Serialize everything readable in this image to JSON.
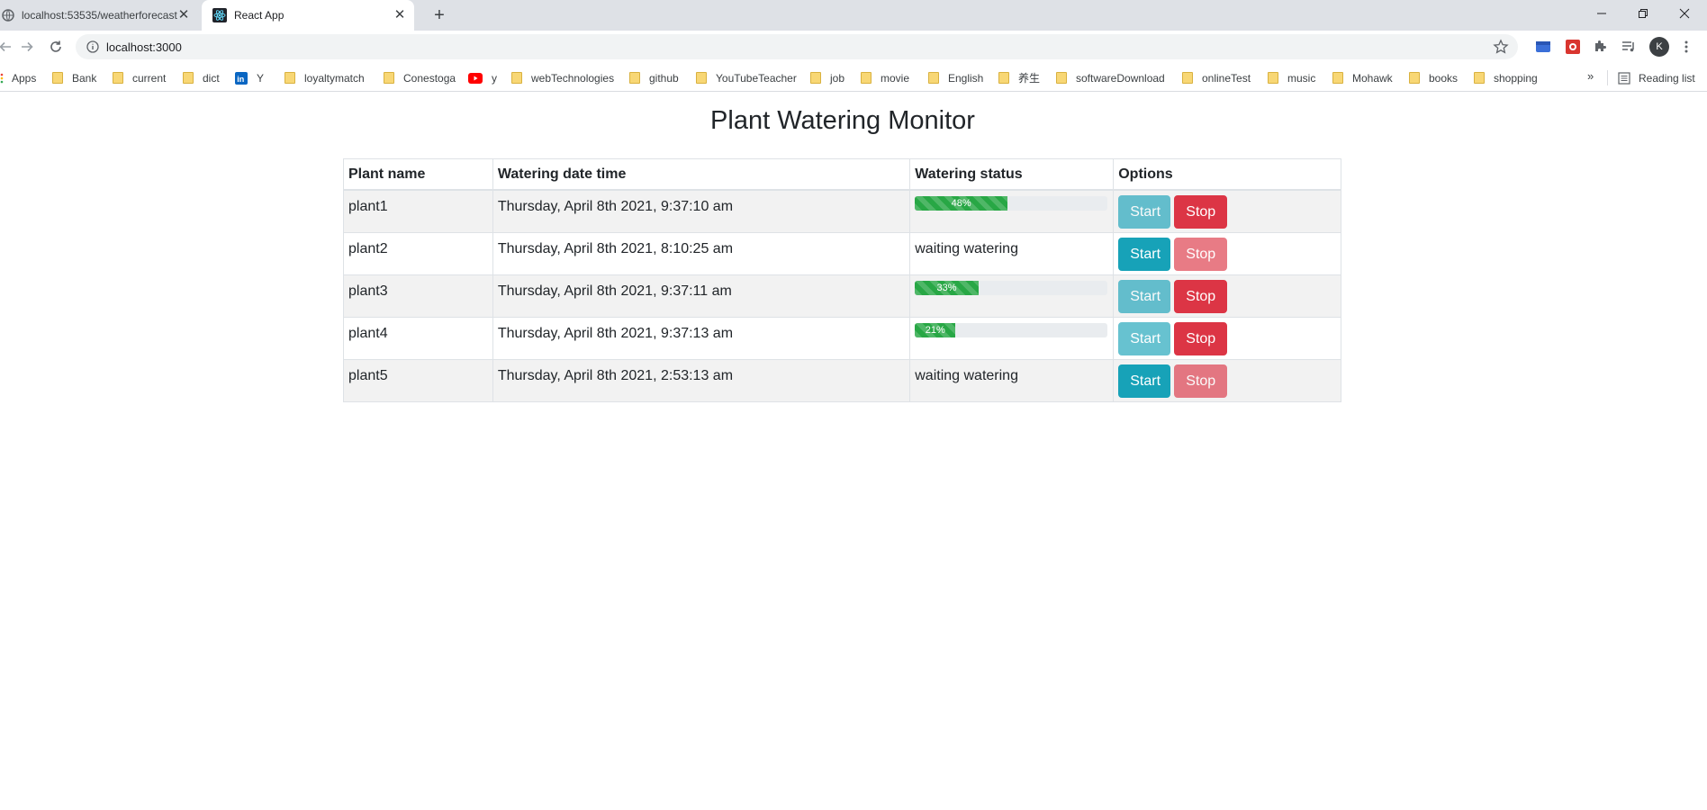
{
  "browser": {
    "tabs": [
      {
        "title": "localhost:53535/weatherforecast",
        "active": false
      },
      {
        "title": "React App",
        "active": true
      }
    ],
    "url": "localhost:3000",
    "profile_initial": "K",
    "bookmarks": [
      "Apps",
      "Bank",
      "current",
      "dict",
      "Y",
      "loyaltymatch",
      "Conestoga",
      "y",
      "webTechnologies",
      "github",
      "YouTubeTeacher",
      "job",
      "movie",
      "English",
      "养生",
      "softwareDownload",
      "onlineTest",
      "music",
      "Mohawk",
      "books",
      "shopping"
    ],
    "reading_list": "Reading list",
    "more": "»"
  },
  "page": {
    "title": "Plant Watering Monitor",
    "columns": [
      "Plant name",
      "Watering date time",
      "Watering status",
      "Options"
    ],
    "start_label": "Start",
    "stop_label": "Stop",
    "rows": [
      {
        "name": "plant1",
        "datetime": "Thursday, April 8th 2021, 9:37:10 am",
        "progress": 48,
        "progress_label": "48%",
        "status_text": "",
        "watering": true
      },
      {
        "name": "plant2",
        "datetime": "Thursday, April 8th 2021, 8:10:25 am",
        "progress": null,
        "progress_label": "",
        "status_text": "waiting watering",
        "watering": false
      },
      {
        "name": "plant3",
        "datetime": "Thursday, April 8th 2021, 9:37:11 am",
        "progress": 33,
        "progress_label": "33%",
        "status_text": "",
        "watering": true
      },
      {
        "name": "plant4",
        "datetime": "Thursday, April 8th 2021, 9:37:13 am",
        "progress": 21,
        "progress_label": "21%",
        "status_text": "",
        "watering": true
      },
      {
        "name": "plant5",
        "datetime": "Thursday, April 8th 2021, 2:53:13 am",
        "progress": null,
        "progress_label": "",
        "status_text": "waiting watering",
        "watering": false
      }
    ]
  },
  "colors": {
    "start": "#17a2b8",
    "stop": "#dc3545",
    "progress": "#28a745"
  }
}
